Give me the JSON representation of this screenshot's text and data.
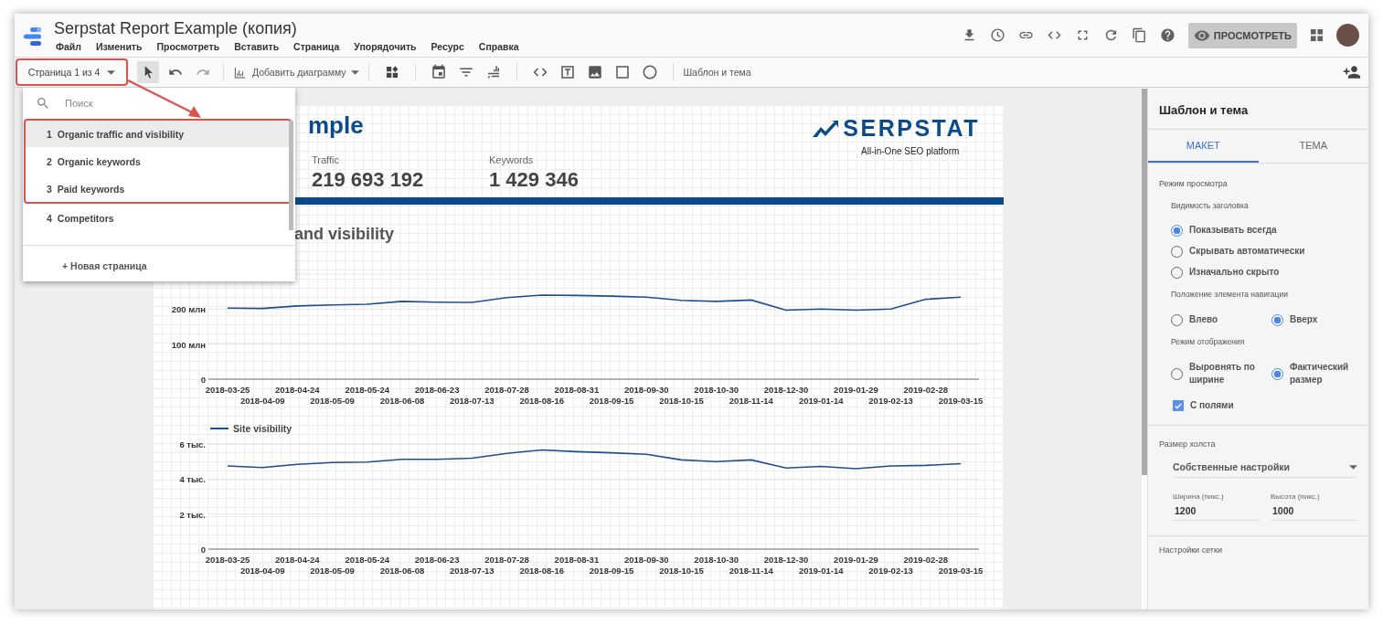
{
  "app": {
    "title": "Serpstat Report Example (копия)",
    "menu": [
      "Файл",
      "Изменить",
      "Просмотреть",
      "Вставить",
      "Страница",
      "Упорядочить",
      "Ресурс",
      "Справка"
    ],
    "preview_button": "ПРОСМОТРЕТЬ"
  },
  "toolbar": {
    "page_selector": {
      "label": "Страница 1 из 4",
      "highlighted": true
    },
    "add_chart": "Добавить диаграмму",
    "theme_button": "Шаблон и тема"
  },
  "page_menu": {
    "search": {
      "placeholder": "Поиск"
    },
    "pages": [
      {
        "number": "1",
        "name": "Organic traffic and visibility",
        "selected": true,
        "highlighted": true
      },
      {
        "number": "2",
        "name": "Organic keywords",
        "selected": false,
        "highlighted": true
      },
      {
        "number": "3",
        "name": "Paid keywords",
        "selected": false,
        "highlighted": true
      },
      {
        "number": "4",
        "name": "Competitors",
        "selected": false,
        "highlighted": false
      }
    ],
    "new_page": "+ Новая страница"
  },
  "report": {
    "title": "mple",
    "logo": {
      "name": "SERPSTAT",
      "tagline": "All-in-One SEO platform"
    },
    "metrics": [
      {
        "label": "Traffic",
        "value": "219 693 192"
      },
      {
        "label": "Keywords",
        "value": "1 429 346"
      }
    ],
    "section_title": "and visibility",
    "charts": [
      {
        "chart_data": {
          "type": "line",
          "categories": [
            "2018-03-25",
            "2018-04-09",
            "2018-04-24",
            "2018-05-09",
            "2018-05-24",
            "2018-06-08",
            "2018-06-23",
            "2018-07-13",
            "2018-07-28",
            "2018-08-16",
            "2018-08-31",
            "2018-09-15",
            "2018-09-30",
            "2018-10-15",
            "2018-10-30",
            "2018-11-14",
            "2018-12-30",
            "2019-01-14",
            "2019-01-29",
            "2019-02-13",
            "2019-02-28",
            "2019-03-15"
          ],
          "ylim": [
            0,
            300
          ],
          "yticks": [
            {
              "value": 0,
              "label": "0"
            },
            {
              "value": 100,
              "label": "100 млн"
            },
            {
              "value": 200,
              "label": "200 млн"
            }
          ],
          "series": [
            {
              "color": "#1f4e8c",
              "values": [
                203,
                202,
                209,
                212,
                214,
                222,
                220,
                219,
                233,
                240,
                239,
                237,
                234,
                225,
                222,
                226,
                197,
                200,
                197,
                200,
                228,
                234
              ]
            }
          ]
        }
      },
      {
        "chart_data": {
          "type": "line",
          "categories": [
            "2018-03-25",
            "2018-04-09",
            "2018-04-24",
            "2018-05-09",
            "2018-05-24",
            "2018-06-08",
            "2018-06-23",
            "2018-07-13",
            "2018-07-28",
            "2018-08-16",
            "2018-08-31",
            "2018-09-15",
            "2018-09-30",
            "2018-10-15",
            "2018-10-30",
            "2018-11-14",
            "2018-12-30",
            "2019-01-14",
            "2019-01-29",
            "2019-02-13",
            "2019-02-28",
            "2019-03-15"
          ],
          "ylim": [
            0,
            6
          ],
          "yticks": [
            {
              "value": 0,
              "label": "0"
            },
            {
              "value": 2,
              "label": "2 тыс."
            },
            {
              "value": 4,
              "label": "4 тыс."
            },
            {
              "value": 6,
              "label": "6 тыс."
            }
          ],
          "series": [
            {
              "name": "Site visibility",
              "color": "#1f4e8c",
              "values": [
                4.75,
                4.66,
                4.84,
                4.94,
                4.97,
                5.13,
                5.13,
                5.19,
                5.47,
                5.66,
                5.56,
                5.5,
                5.41,
                5.09,
                5.0,
                5.09,
                4.63,
                4.72,
                4.59,
                4.75,
                4.78,
                4.88
              ]
            }
          ]
        }
      }
    ]
  },
  "panel": {
    "title": "Шаблон и тема",
    "tabs": [
      {
        "label": "МАКЕТ",
        "selected": true
      },
      {
        "label": "ТЕМА",
        "selected": false
      }
    ],
    "view_mode": {
      "label": "Режим просмотра",
      "groups": [
        {
          "label": "Видимость заголовка",
          "options": [
            {
              "label": "Показывать всегда",
              "selected": true
            },
            {
              "label": "Скрывать автоматически",
              "selected": false
            },
            {
              "label": "Изначально скрыто",
              "selected": false
            }
          ]
        },
        {
          "label": "Положение элемента навигации",
          "options": [
            {
              "label": "Влево",
              "selected": false
            },
            {
              "label": "Вверх",
              "selected": true
            }
          ]
        },
        {
          "label": "Режим отображения",
          "options": [
            {
              "label": "Выровнять по ширине",
              "selected": false
            },
            {
              "label": "Фактический размер",
              "selected": true
            }
          ]
        }
      ],
      "margins": {
        "label": "С полями",
        "checked": true
      }
    },
    "canvas_size": {
      "label": "Размер холста",
      "preset": "Собственные настройки",
      "width": {
        "label": "Ширина (пикс.)",
        "value": "1200"
      },
      "height": {
        "label": "Высота (пикс.)",
        "value": "1000"
      }
    },
    "grid_settings": {
      "label": "Настройки сетки"
    }
  }
}
